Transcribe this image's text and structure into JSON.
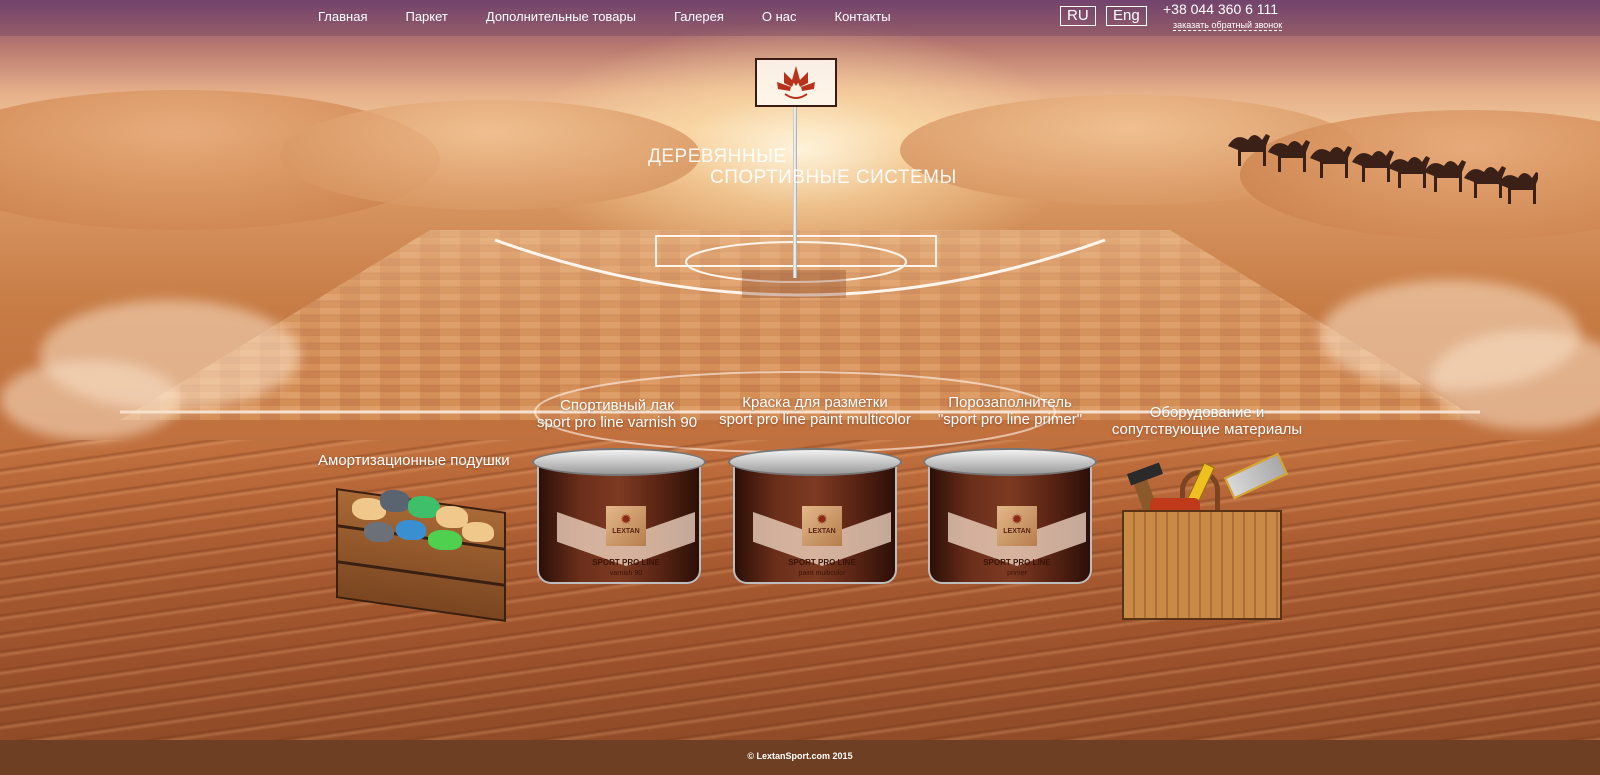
{
  "nav": {
    "items": [
      "Главная",
      "Паркет",
      "Дополнительные товары",
      "Галерея",
      "О нас",
      "Контакты"
    ]
  },
  "lang": {
    "ru": "RU",
    "en": "Eng"
  },
  "contact": {
    "phone": "+38 044 360 6 111",
    "callback": "заказать обратный звонок"
  },
  "hero": {
    "title_line1": "ДЕРЕВЯННЫЕ",
    "title_line2": "СПОРТИВНЫЕ СИСТЕМЫ"
  },
  "products": [
    {
      "line1": "Амортизационные подушки",
      "line2": ""
    },
    {
      "line1": "Спортивный лак",
      "line2": "sport pro line varnish 90"
    },
    {
      "line1": "Краска для разметки",
      "line2": "sport pro line paint multicolor"
    },
    {
      "line1": "Порозаполнитель",
      "line2": "\"sport pro line primer\""
    },
    {
      "line1": "Оборудование и",
      "line2": "сопутствующие материалы"
    }
  ],
  "cans": [
    {
      "brand": "LEXTAN",
      "brand_sub": "sport",
      "name": "SPORT PRO LINE",
      "sub": "varnish 90"
    },
    {
      "brand": "LEXTAN",
      "brand_sub": "sport",
      "name": "SPORT PRO LINE",
      "sub": "paint multicolor"
    },
    {
      "brand": "LEXTAN",
      "brand_sub": "sport",
      "name": "SPORT PRO LINE",
      "sub": "primer"
    }
  ],
  "footer": {
    "copyright": "© LextanSport.com 2015"
  },
  "colors": {
    "footer_bg": "#6e3f23",
    "can_body": "#6a2e1a",
    "nav_text": "#ffffff"
  }
}
